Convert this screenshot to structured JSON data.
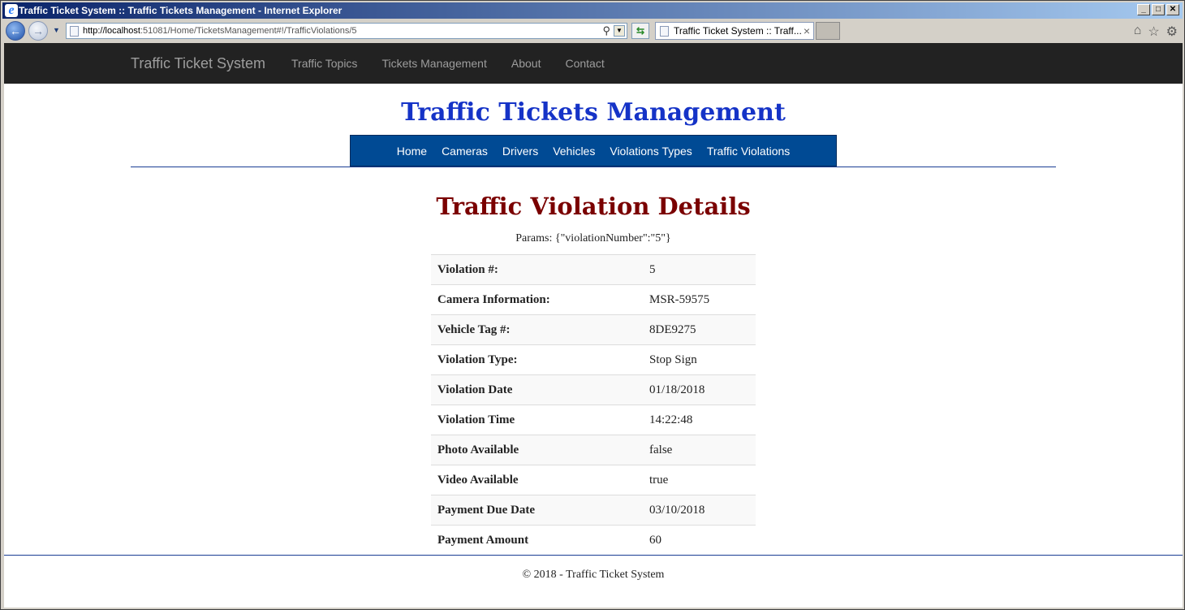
{
  "window": {
    "title": "Traffic Ticket System :: Traffic Tickets Management - Internet Explorer",
    "controls": [
      "0",
      "1",
      "r"
    ]
  },
  "browser": {
    "url_host": "http://localhost",
    "url_path": ":51081/Home/TicketsManagement#!/TrafficViolations/5",
    "tab_title": "Traffic Ticket System :: Traff...",
    "tab_close": "×"
  },
  "navbar": {
    "brand": "Traffic Ticket System",
    "links": [
      "Traffic Topics",
      "Tickets Management",
      "About",
      "Contact"
    ]
  },
  "header": {
    "title": "Traffic Tickets Management"
  },
  "subnav": {
    "links": [
      "Home",
      "Cameras",
      "Drivers",
      "Vehicles",
      "Violations Types",
      "Traffic Violations"
    ]
  },
  "details": {
    "title": "Traffic Violation Details",
    "params": "Params: {\"violationNumber\":\"5\"}",
    "rows": [
      {
        "label": "Violation #:",
        "value": "5"
      },
      {
        "label": "Camera Information:",
        "value": "MSR-59575"
      },
      {
        "label": "Vehicle Tag #:",
        "value": "8DE9275"
      },
      {
        "label": "Violation Type:",
        "value": "Stop Sign"
      },
      {
        "label": "Violation Date",
        "value": "01/18/2018"
      },
      {
        "label": "Violation Time",
        "value": "14:22:48"
      },
      {
        "label": "Photo Available",
        "value": "false"
      },
      {
        "label": "Video Available",
        "value": "true"
      },
      {
        "label": "Payment Due Date",
        "value": "03/10/2018"
      },
      {
        "label": "Payment Amount",
        "value": "60"
      }
    ]
  },
  "footer": {
    "text": "© 2018 - Traffic Ticket System"
  }
}
